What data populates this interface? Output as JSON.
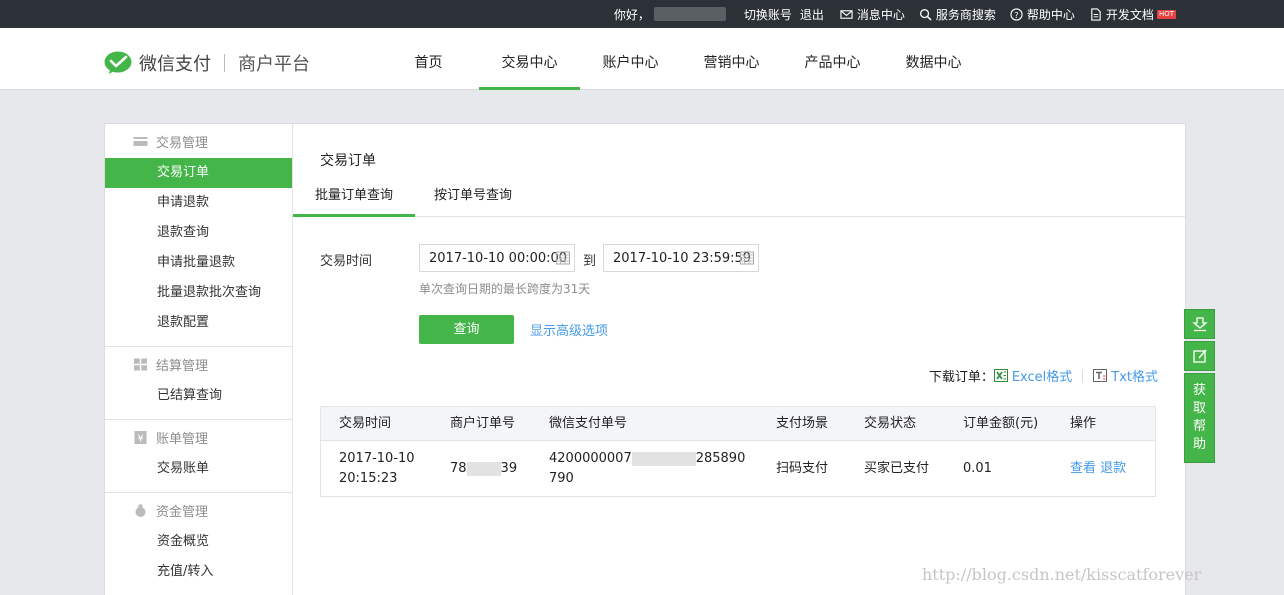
{
  "topbar": {
    "greeting": "你好，",
    "switch_account": "切换账号",
    "logout": "退出",
    "messages": "消息中心",
    "provider_search": "服务商搜索",
    "help_center": "帮助中心",
    "dev_docs": "开发文档",
    "hot_badge": "HOT"
  },
  "header": {
    "brand": "微信支付",
    "platform": "商户平台",
    "nav": [
      "首页",
      "交易中心",
      "账户中心",
      "营销中心",
      "产品中心",
      "数据中心"
    ],
    "active_nav": 1
  },
  "sidebar": {
    "groups": [
      {
        "title": "交易管理",
        "items": [
          "交易订单",
          "申请退款",
          "退款查询",
          "申请批量退款",
          "批量退款批次查询",
          "退款配置"
        ]
      },
      {
        "title": "结算管理",
        "items": [
          "已结算查询"
        ]
      },
      {
        "title": "账单管理",
        "items": [
          "交易账单"
        ]
      },
      {
        "title": "资金管理",
        "items": [
          "资金概览",
          "充值/转入"
        ]
      }
    ],
    "active_item": "交易订单"
  },
  "content": {
    "title": "交易订单",
    "tabs": [
      "批量订单查询",
      "按订单号查询"
    ],
    "active_tab": 0,
    "filter": {
      "label": "交易时间",
      "start": "2017-10-10 00:00:00",
      "to": "到",
      "end": "2017-10-10 23:59:59",
      "hint": "单次查询日期的最长跨度为31天"
    },
    "query_button": "查询",
    "advanced_link": "显示高级选项",
    "download": {
      "label": "下载订单：",
      "excel": "Excel格式",
      "txt": "Txt格式"
    },
    "table": {
      "columns": [
        "交易时间",
        "商户订单号",
        "微信支付单号",
        "支付场景",
        "交易状态",
        "订单金额(元)",
        "操作"
      ],
      "rows": [
        {
          "time_date": "2017-10-10",
          "time_clock": "20:15:23",
          "merchant_no_prefix": "78",
          "merchant_no_suffix": "39",
          "wx_no_prefix": "4200000007",
          "wx_no_suffix": "285890",
          "wx_no_line2": "790",
          "scene": "扫码支付",
          "status": "买家已支付",
          "amount": "0.01",
          "action_view": "查看",
          "action_refund": "退款"
        }
      ]
    }
  },
  "float_help": {
    "help_chars": [
      "获",
      "取",
      "帮",
      "助"
    ]
  },
  "watermark": "http://blog.csdn.net/kisscatforever",
  "colors": {
    "accent": "#44b549",
    "link": "#459ae9",
    "topbar": "#2b3137"
  }
}
